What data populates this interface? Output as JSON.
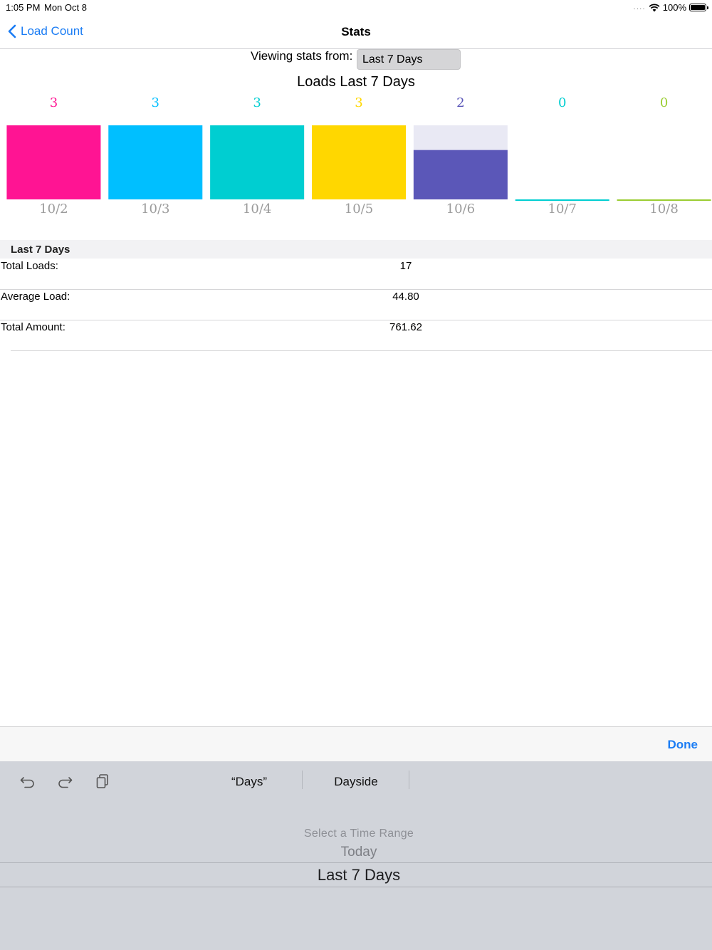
{
  "status_bar": {
    "time": "1:05 PM",
    "date": "Mon Oct 8",
    "signal": "․․․․",
    "battery": "100%"
  },
  "nav": {
    "back_label": "Load Count",
    "title": "Stats"
  },
  "viewing": {
    "label": "Viewing stats from:",
    "value": "Last 7 Days"
  },
  "chart_data": {
    "type": "bar",
    "title": "Loads Last 7 Days",
    "categories": [
      "10/2",
      "10/3",
      "10/4",
      "10/5",
      "10/6",
      "10/7",
      "10/8"
    ],
    "values": [
      3,
      3,
      3,
      3,
      2,
      0,
      0
    ],
    "ylim": [
      0,
      3
    ],
    "colors": [
      "#ff1493",
      "#00bfff",
      "#00ced1",
      "#ffd700",
      "#5b57b8",
      "#00ced1",
      "#9acd32"
    ],
    "track_color": "#e9e9f4",
    "value_label_colors": [
      "#ff1493",
      "#00bfff",
      "#00ced1",
      "#ffd700",
      "#5b57b8",
      "#00ced1",
      "#9acd32"
    ],
    "category_label_color": "#9b9b9b"
  },
  "stats": {
    "section_title": "Last 7 Days",
    "rows": [
      {
        "label": "Total Loads:",
        "value": "17"
      },
      {
        "label": "Average Load:",
        "value": "44.80"
      },
      {
        "label": "Total Amount:",
        "value": "761.62"
      }
    ]
  },
  "accessory": {
    "done_label": "Done"
  },
  "keyboard": {
    "icons": [
      "undo-icon",
      "redo-icon",
      "clipboard-icon"
    ],
    "suggestions": [
      "“Days”",
      "Dayside"
    ]
  },
  "picker": {
    "items": [
      "Select a Time Range",
      "Today",
      "Last 7 Days"
    ],
    "selected": "Last 7 Days"
  },
  "colors": {
    "accent": "#1a7cf4",
    "keyboard_bg": "#d1d4da"
  }
}
